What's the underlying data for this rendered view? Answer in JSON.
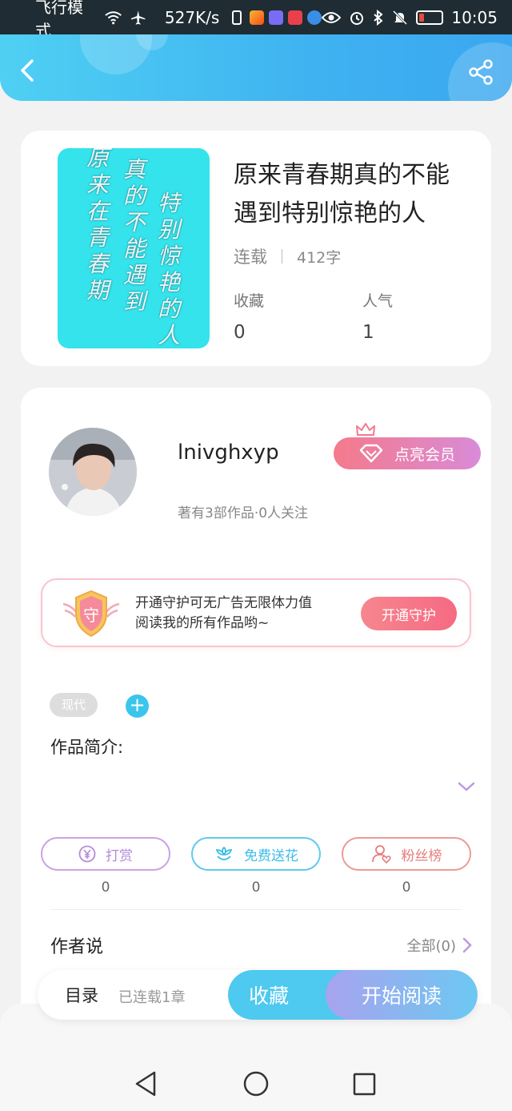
{
  "status_bar": {
    "airplane_mode": "飞行模式",
    "speed": "527K/s",
    "time": "10:05",
    "icons": [
      "wifi-icon",
      "airplane-icon",
      "phone-icon",
      "eye-icon",
      "alarm-icon",
      "bluetooth-icon",
      "mute-icon",
      "battery-icon"
    ]
  },
  "header": {
    "back_icon": "chevron-left-icon",
    "share_icon": "share-icon",
    "accent_color": "#3fb3f1"
  },
  "book": {
    "title": "原来青春期真的不能遇到特别惊艳的人",
    "status": "连载",
    "word_count": "412字",
    "favorites_label": "收藏",
    "favorites_value": "0",
    "popularity_label": "人气",
    "popularity_value": "1"
  },
  "author": {
    "name": "lnivghxyp",
    "subtitle": "著有3部作品·0人关注",
    "vip_button": "点亮会员"
  },
  "guard": {
    "badge": "守",
    "text_line1": "开通守护可无广告无限体力值",
    "text_line2": "阅读我的所有作品哟~",
    "button": "开通守护"
  },
  "tags": [
    "现代"
  ],
  "add_tag": "+",
  "intro_label": "作品简介:",
  "actions": [
    {
      "label": "打赏",
      "count": "0",
      "icon": "yen-icon",
      "color": "#c9a3e6"
    },
    {
      "label": "免费送花",
      "count": "0",
      "icon": "flower-icon",
      "color": "#5fcbee"
    },
    {
      "label": "粉丝榜",
      "count": "0",
      "icon": "fans-icon",
      "color": "#ef9a9a"
    }
  ],
  "author_say": {
    "label": "作者说",
    "all_link": "全部(0)"
  },
  "bottom_bar": {
    "toc": "目录",
    "toc_sub": "已连载1章",
    "favorite": "收藏",
    "start_reading": "开始阅读"
  }
}
